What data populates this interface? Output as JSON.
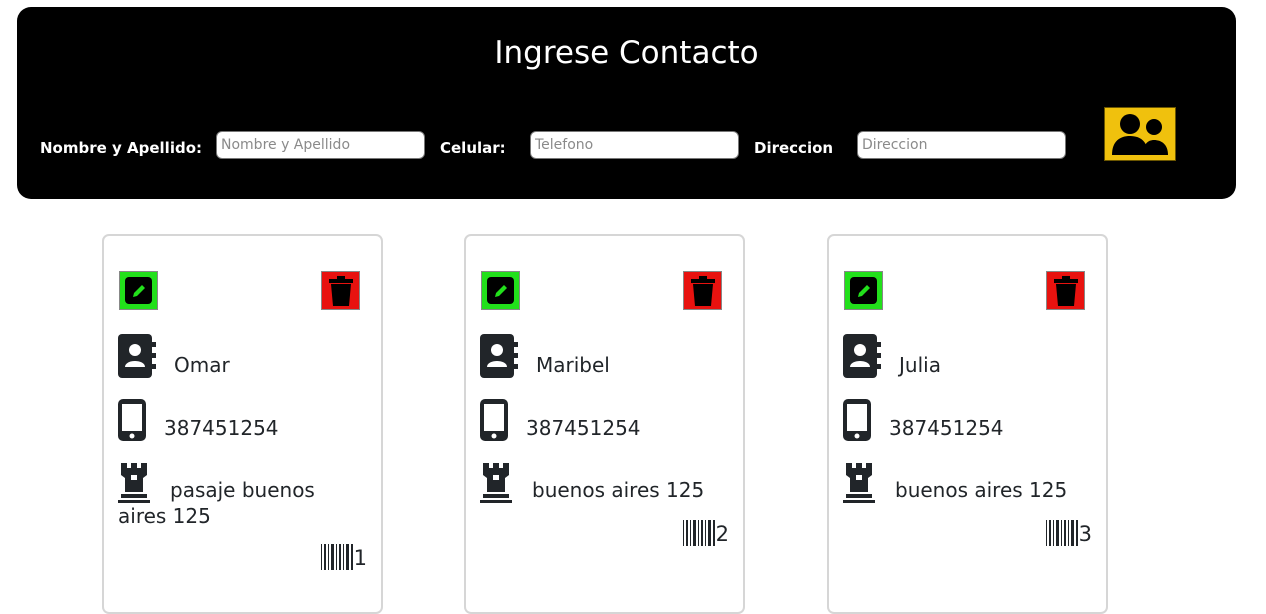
{
  "header": {
    "title": "Ingrese Contacto",
    "labels": {
      "name": "Nombre y Apellido:",
      "phone": "Celular:",
      "address": "Direccion"
    },
    "placeholders": {
      "name": "Nombre y Apellido",
      "phone": "Telefono",
      "address": "Direccion"
    },
    "add_button_icon": "users-icon",
    "add_button_color": "#f0c10d"
  },
  "contacts": [
    {
      "name": "Omar",
      "phone": "387451254",
      "address": "pasaje buenos aires 125",
      "id": "1"
    },
    {
      "name": "Maribel",
      "phone": "387451254",
      "address": "buenos aires 125",
      "id": "2"
    },
    {
      "name": "Julia",
      "phone": "387451254",
      "address": "buenos aires 125",
      "id": "3"
    }
  ],
  "colors": {
    "edit_button": "#22e01b",
    "delete_button": "#e8120f",
    "header_bg": "#000000"
  },
  "icons": {
    "edit": "pencil-icon",
    "delete": "trash-icon",
    "name": "address-book-icon",
    "phone": "mobile-phone-icon",
    "address": "chess-rook-icon",
    "id": "barcode-icon"
  }
}
